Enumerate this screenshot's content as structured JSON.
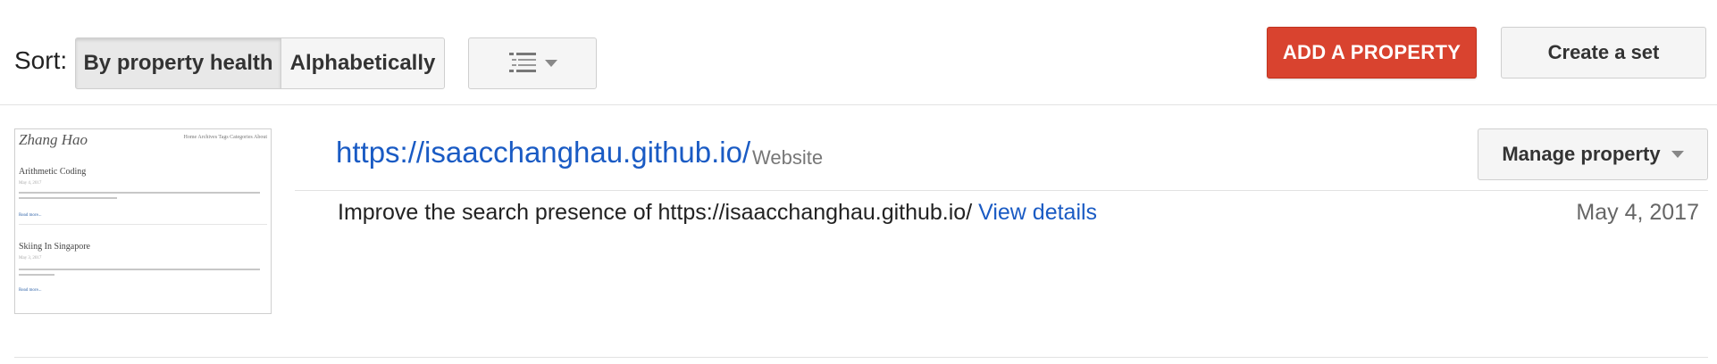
{
  "toolbar": {
    "sort_label": "Sort:",
    "sort_options": [
      "By property health",
      "Alphabetically"
    ],
    "selected_sort": "By property health",
    "view_toggle_icon": "list-view-icon",
    "add_property_label": "ADD A PROPERTY",
    "create_set_label": "Create a set"
  },
  "colors": {
    "accent_red": "#d9432f",
    "link_blue": "#1a5bc4"
  },
  "property": {
    "url": "https://isaacchanghau.github.io/",
    "type": "Website",
    "manage_label": "Manage property",
    "message_text": "Improve the search presence of https://isaacchanghau.github.io/",
    "details_link": "View details",
    "date": "May 4, 2017",
    "thumbnail": {
      "brand": "Zhang Hao",
      "nav": "Home  Archives  Tags  Categories  About",
      "posts": [
        {
          "title": "Arithmetic Coding",
          "date": "May 4, 2017",
          "more": "Read more..."
        },
        {
          "title": "Skiing In Singapore",
          "date": "May 3, 2017",
          "more": "Read more..."
        }
      ]
    }
  }
}
